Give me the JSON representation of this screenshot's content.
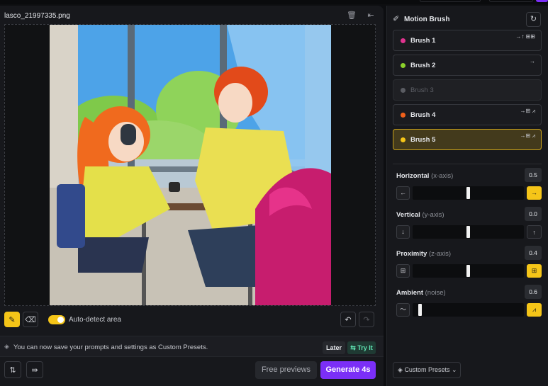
{
  "file": {
    "name": "lasco_21997335.png"
  },
  "toolbar": {
    "auto_detect_label": "Auto-detect area"
  },
  "notice": {
    "text": "You can now save your prompts and settings as Custom Presets.",
    "later_label": "Later",
    "try_label": "Try It"
  },
  "actions": {
    "free_previews_label": "Free previews",
    "generate_label": "Generate 4s"
  },
  "panel": {
    "title": "Motion Brush",
    "brushes": [
      {
        "label": "Brush 1",
        "color": "#e0338f",
        "icons": "→↑ ⊞⊞"
      },
      {
        "label": "Brush 2",
        "color": "#8bd12b",
        "icons": "→"
      },
      {
        "label": "Brush 3",
        "color": "#5a5c62",
        "icons": ""
      },
      {
        "label": "Brush 4",
        "color": "#f0601a",
        "icons": "→⊞ ⩘"
      },
      {
        "label": "Brush 5",
        "color": "#f5c518",
        "icons": "→⊞ ⩘"
      }
    ],
    "axes": [
      {
        "label": "Horizontal",
        "sub": "(x-axis)",
        "value": "0.5",
        "pos": 0.5,
        "left_icon": "←",
        "right_icon": "→",
        "right_on": true
      },
      {
        "label": "Vertical",
        "sub": "(y-axis)",
        "value": "0.0",
        "pos": 0.5,
        "left_icon": "↓",
        "right_icon": "↑",
        "right_on": false
      },
      {
        "label": "Proximity",
        "sub": "(z-axis)",
        "value": "0.4",
        "pos": 0.5,
        "left_icon": "⊞",
        "right_icon": "⊞",
        "right_on": true
      },
      {
        "label": "Ambient",
        "sub": "(noise)",
        "value": "0.6",
        "pos": 0.05,
        "left_icon": "〜",
        "right_icon": "⩘",
        "right_on": true
      }
    ],
    "presets_label": "Custom Presets"
  },
  "colors": {
    "accent": "#7b2ff7",
    "brush_active": "#f5c518",
    "try_green": "#5fe3b2"
  }
}
